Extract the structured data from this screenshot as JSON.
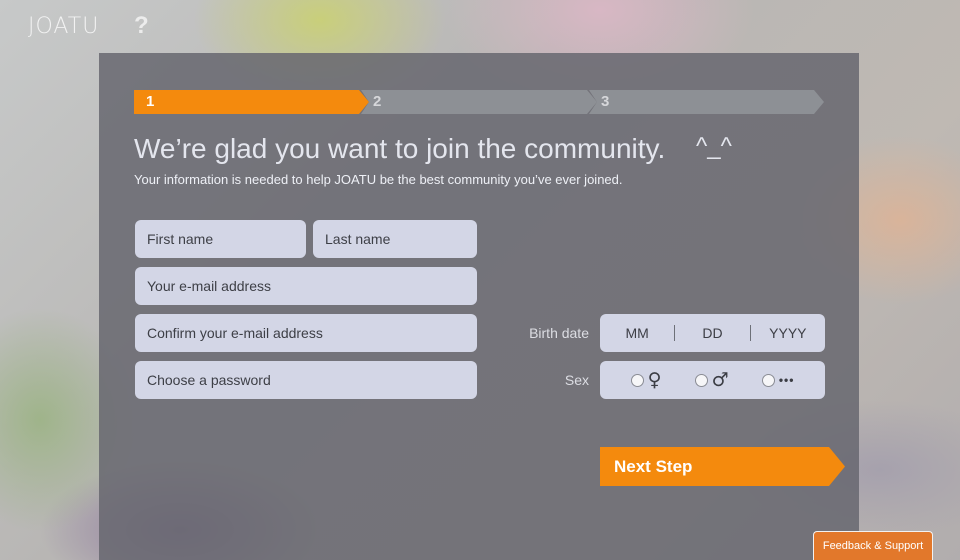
{
  "header": {
    "logo_text": "JOATU",
    "help_label": "?"
  },
  "steps": [
    {
      "label": "1",
      "state": "active"
    },
    {
      "label": "2",
      "state": "inactive"
    },
    {
      "label": "3",
      "state": "inactive"
    }
  ],
  "main": {
    "headline": "We’re glad you want to join the community.",
    "emoticon": "^_^",
    "subline": "Your information is needed to help JOATU be the best community you’ve ever joined."
  },
  "form": {
    "first_name": {
      "placeholder": "First name",
      "value": ""
    },
    "last_name": {
      "placeholder": "Last name",
      "value": ""
    },
    "email": {
      "placeholder": "Your e-mail address",
      "value": ""
    },
    "email_confirm": {
      "placeholder": "Confirm your e-mail address",
      "value": ""
    },
    "password": {
      "placeholder": "Choose a password",
      "value": ""
    },
    "birth_label": "Birth date",
    "birth_mm": "MM",
    "birth_dd": "DD",
    "birth_yyyy": "YYYY",
    "sex_label": "Sex",
    "sex_options": [
      {
        "icon": "female-icon",
        "glyph": "♀"
      },
      {
        "icon": "male-icon",
        "glyph": "♂"
      },
      {
        "icon": "other-icon",
        "glyph": "•••"
      }
    ],
    "next_label": "Next Step"
  },
  "footer": {
    "feedback_label": "Feedback & Support"
  },
  "colors": {
    "accent": "#f48a0d",
    "panel": "#68686f",
    "field": "#d3d6e6",
    "feedback": "#e2782b"
  }
}
